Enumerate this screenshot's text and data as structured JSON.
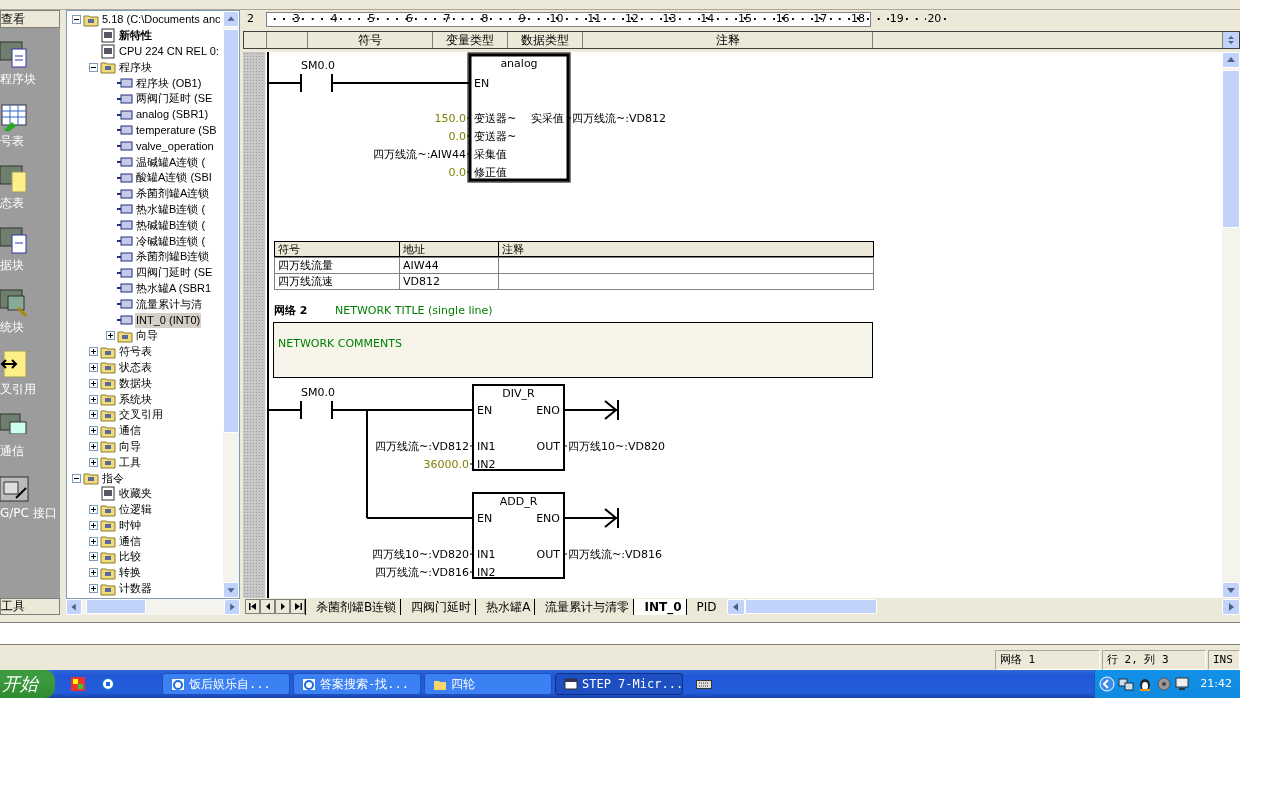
{
  "nav_bar": {
    "title": "查看",
    "items": [
      {
        "label": "程序块"
      },
      {
        "label": "号表"
      },
      {
        "label": "态表"
      },
      {
        "label": "据块"
      },
      {
        "label": "统块"
      },
      {
        "label": "叉引用"
      },
      {
        "label": "通信"
      },
      {
        "label": "G/PC 接口"
      }
    ],
    "footer": "工具"
  },
  "tree": [
    {
      "label": "5.18 (C:\\Documents anc",
      "expanded": true,
      "selected": false,
      "children": [
        {
          "label": "新特性",
          "bold": true,
          "selected": false
        },
        {
          "label": "CPU 224 CN REL 0:",
          "selected": false
        },
        {
          "label": "程序块",
          "expanded": true,
          "selected": false,
          "children": [
            {
              "label": "程序块 (OB1)",
              "selected": false
            },
            {
              "label": "两阀门延时 (SE",
              "selected": false
            },
            {
              "label": "analog (SBR1)",
              "selected": false
            },
            {
              "label": "temperature (SB",
              "selected": false
            },
            {
              "label": "valve_operation",
              "selected": false
            },
            {
              "label": "温碱罐A连锁 (",
              "selected": false
            },
            {
              "label": "酸罐A连锁 (SBI",
              "selected": false
            },
            {
              "label": "杀菌剂罐A连锁",
              "selected": false
            },
            {
              "label": "热水罐B连锁 (",
              "selected": false
            },
            {
              "label": "热碱罐B连锁 (",
              "selected": false
            },
            {
              "label": "冷碱罐B连锁 (",
              "selected": false
            },
            {
              "label": "杀菌剂罐B连锁",
              "selected": false
            },
            {
              "label": "四阀门延时 (SE",
              "selected": false
            },
            {
              "label": "热水罐A (SBR1",
              "selected": false
            },
            {
              "label": "流量累计与清",
              "selected": false
            },
            {
              "label": "INT_0 (INT0)",
              "selected": true
            },
            {
              "label": "向导",
              "expanded": false,
              "selected": false
            }
          ]
        },
        {
          "label": "符号表",
          "expanded": false,
          "selected": false
        },
        {
          "label": "状态表",
          "expanded": false,
          "selected": false
        },
        {
          "label": "数据块",
          "expanded": false,
          "selected": false
        },
        {
          "label": "系统块",
          "expanded": false,
          "selected": false
        },
        {
          "label": "交叉引用",
          "expanded": false,
          "selected": false
        },
        {
          "label": "通信",
          "expanded": false,
          "selected": false
        },
        {
          "label": "向导",
          "expanded": false,
          "selected": false
        },
        {
          "label": "工具",
          "expanded": false,
          "selected": false
        }
      ]
    },
    {
      "label": "指令",
      "expanded": true,
      "selected": false,
      "children": [
        {
          "label": "收藏夹",
          "selected": false
        },
        {
          "label": "位逻辑",
          "expanded": false,
          "selected": false
        },
        {
          "label": "时钟",
          "expanded": false,
          "selected": false
        },
        {
          "label": "通信",
          "expanded": false,
          "selected": false
        },
        {
          "label": "比较",
          "expanded": false,
          "selected": false
        },
        {
          "label": "转换",
          "expanded": false,
          "selected": false
        },
        {
          "label": "计数器",
          "expanded": false,
          "selected": false
        }
      ]
    }
  ],
  "ruler": {
    "before": [
      "2"
    ],
    "page": [
      "3",
      "4",
      "5",
      "6",
      "7",
      "8",
      "9",
      "10",
      "11",
      "12",
      "13",
      "14",
      "15",
      "16",
      "17",
      "18"
    ],
    "after": [
      "19",
      "20"
    ]
  },
  "table_header": [
    "符号",
    "变量类型",
    "数据类型",
    "注释"
  ],
  "networks": [
    {
      "contact": "SM0.0",
      "boxes": [
        {
          "title": "analog",
          "en": "EN",
          "inputs": [
            {
              "pin": "变送器~",
              "value": "150.0",
              "kind": "constant"
            },
            {
              "pin": "变送器~",
              "value": "0.0",
              "kind": "constant"
            },
            {
              "pin": "采集值",
              "value": "四万线流~:AIW44",
              "kind": "symbol"
            },
            {
              "pin": "修正值",
              "value": "0.0",
              "kind": "constant"
            }
          ],
          "outputs": [
            {
              "pin": "实采值",
              "value": "四万线流~:VD812"
            }
          ]
        }
      ],
      "symbols": {
        "columns": [
          "符号",
          "地址",
          "注释"
        ],
        "rows": [
          [
            "四万线流量",
            "AIW44"
          ],
          [
            "四万线流速",
            "VD812"
          ]
        ]
      }
    },
    {
      "label": "网络 2",
      "title": "NETWORK TITLE (single line)",
      "comment": "NETWORK COMMENTS",
      "contact": "SM0.0",
      "boxes": [
        {
          "title": "DIV_R",
          "en": "EN",
          "eno": "ENO",
          "inputs": [
            {
              "pin": "IN1",
              "value": "四万线流~:VD812",
              "kind": "symbol"
            },
            {
              "pin": "IN2",
              "value": "36000.0",
              "kind": "constant"
            }
          ],
          "outputs": [
            {
              "pin": "OUT",
              "value": "四万线10~:VD820"
            }
          ]
        },
        {
          "title": "ADD_R",
          "en": "EN",
          "eno": "ENO",
          "inputs": [
            {
              "pin": "IN1",
              "value": "四万线10~:VD820",
              "kind": "symbol"
            },
            {
              "pin": "IN2",
              "value": "四万线流~:VD816",
              "kind": "symbol"
            }
          ],
          "outputs": [
            {
              "pin": "OUT",
              "value": "四万线流~:VD816"
            }
          ]
        }
      ]
    }
  ],
  "editor_tabs": [
    {
      "label": "杀菌剂罐B连锁",
      "selected": false
    },
    {
      "label": "四阀门延时",
      "selected": false
    },
    {
      "label": "热水罐A",
      "selected": false
    },
    {
      "label": "流量累计与清零",
      "selected": false
    },
    {
      "label": "INT_0",
      "selected": true
    },
    {
      "label": "PID",
      "selected": false
    }
  ],
  "status_bar": [
    "网络 1",
    "行 2, 列 3",
    "INS"
  ],
  "taskbar": {
    "start": "开始",
    "tasks": [
      {
        "label": "饭后娱乐自...",
        "selected": false
      },
      {
        "label": "答案搜索-找...",
        "selected": false
      },
      {
        "label": "四轮",
        "selected": false
      },
      {
        "label": "STEP 7-Micr...",
        "selected": true
      }
    ],
    "clock": "21:42"
  }
}
